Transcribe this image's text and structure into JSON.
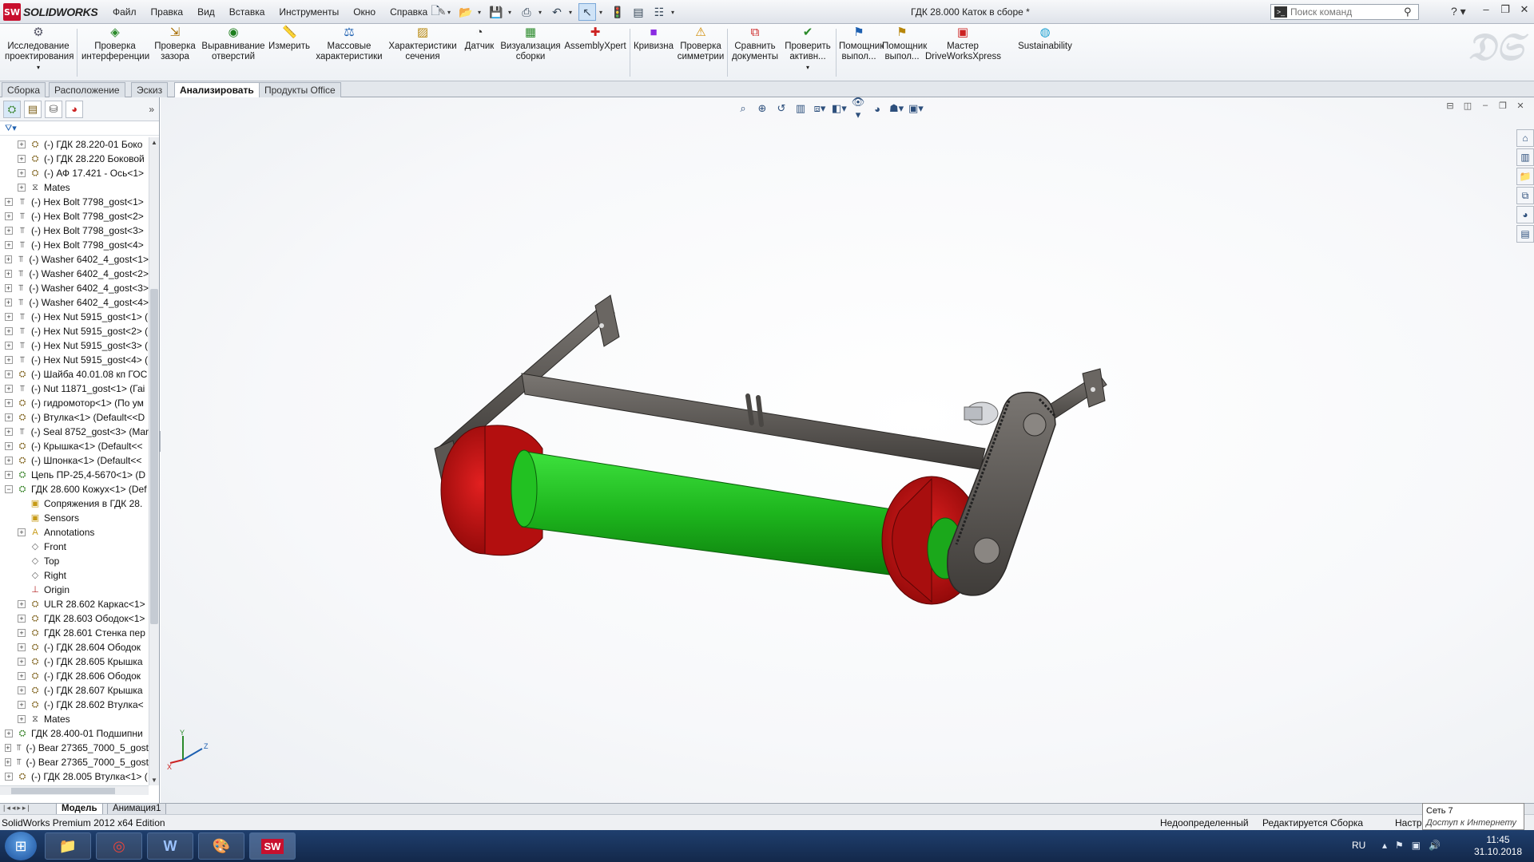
{
  "titlebar": {
    "app_logo_mark": "SW",
    "app_name": "SOLIDWORKS",
    "menu": [
      "Файл",
      "Правка",
      "Вид",
      "Вставка",
      "Инструменты",
      "Окно",
      "Справка"
    ],
    "document_title": "ГДК 28.000 Каток в сборе *",
    "search_placeholder": "Поиск команд",
    "help_label": "?"
  },
  "ribbon": {
    "buttons": [
      {
        "label": "Исследование проектирования",
        "icon": "design-study-icon"
      },
      {
        "label": "Проверка интерференции",
        "icon": "interference-icon"
      },
      {
        "label": "Проверка зазора",
        "icon": "clearance-icon"
      },
      {
        "label": "Выравнивание отверстий",
        "icon": "hole-alignment-icon"
      },
      {
        "label": "Измерить",
        "icon": "measure-icon"
      },
      {
        "label": "Массовые характеристики",
        "icon": "mass-properties-icon"
      },
      {
        "label": "Характеристики сечения",
        "icon": "section-properties-icon"
      },
      {
        "label": "Датчик",
        "icon": "sensor-icon"
      },
      {
        "label": "Визуализация сборки",
        "icon": "assembly-visualization-icon"
      },
      {
        "label": "AssemblyXpert",
        "icon": "assemblyxpert-icon"
      },
      {
        "label": "Кривизна",
        "icon": "curvature-icon"
      },
      {
        "label": "Проверка симметрии",
        "icon": "symmetry-check-icon"
      },
      {
        "label": "Сравнить документы",
        "icon": "compare-documents-icon"
      },
      {
        "label": "Проверить активн...",
        "icon": "check-active-icon"
      },
      {
        "label": "Помощник выпол...",
        "icon": "assistant-icon"
      },
      {
        "label": "Помощник выпол...",
        "icon": "assistant-icon"
      },
      {
        "label": "Мастер DriveWorksXpress",
        "icon": "driveworks-icon"
      },
      {
        "label": "Sustainability",
        "icon": "sustainability-icon"
      }
    ]
  },
  "tabs": [
    {
      "label": "Сборка",
      "active": false
    },
    {
      "label": "Расположение",
      "active": false
    },
    {
      "label": "Эскиз",
      "active": false
    },
    {
      "label": "Анализировать",
      "active": true
    },
    {
      "label": "Продукты Office",
      "active": false
    }
  ],
  "tree": {
    "items": [
      {
        "label": "(-) ГДК 28.220-01 Боко",
        "icon": "part",
        "level": 1
      },
      {
        "label": "(-) ГДК 28.220 Боковой",
        "icon": "part",
        "level": 1
      },
      {
        "label": "(-) АФ 17.421 - Ось<1>",
        "icon": "part",
        "level": 1
      },
      {
        "label": "Mates",
        "icon": "mates",
        "level": 1
      },
      {
        "label": "(-) Hex Bolt 7798_gost<1>",
        "icon": "bolt",
        "level": 0
      },
      {
        "label": "(-) Hex Bolt 7798_gost<2>",
        "icon": "bolt",
        "level": 0
      },
      {
        "label": "(-) Hex Bolt 7798_gost<3>",
        "icon": "bolt",
        "level": 0
      },
      {
        "label": "(-) Hex Bolt 7798_gost<4>",
        "icon": "bolt",
        "level": 0
      },
      {
        "label": "(-) Washer 6402_4_gost<1>",
        "icon": "bolt",
        "level": 0
      },
      {
        "label": "(-) Washer 6402_4_gost<2>",
        "icon": "bolt",
        "level": 0
      },
      {
        "label": "(-) Washer 6402_4_gost<3>",
        "icon": "bolt",
        "level": 0
      },
      {
        "label": "(-) Washer 6402_4_gost<4>",
        "icon": "bolt",
        "level": 0
      },
      {
        "label": "(-) Hex Nut 5915_gost<1> (",
        "icon": "bolt",
        "level": 0
      },
      {
        "label": "(-) Hex Nut 5915_gost<2> (",
        "icon": "bolt",
        "level": 0
      },
      {
        "label": "(-) Hex Nut 5915_gost<3> (",
        "icon": "bolt",
        "level": 0
      },
      {
        "label": "(-) Hex Nut 5915_gost<4> (",
        "icon": "bolt",
        "level": 0
      },
      {
        "label": "(-) Шайба 40.01.08 кп ГОС",
        "icon": "part",
        "level": 0
      },
      {
        "label": "(-) Nut 11871_gost<1> (Гаі",
        "icon": "bolt",
        "level": 0
      },
      {
        "label": "(-) гидромотор<1> (По ум",
        "icon": "part",
        "level": 0
      },
      {
        "label": "(-) Втулка<1> (Default<<D",
        "icon": "part",
        "level": 0
      },
      {
        "label": "(-) Seal 8752_gost<3> (Mar",
        "icon": "bolt",
        "level": 0
      },
      {
        "label": "(-) Крышка<1> (Default<<",
        "icon": "part",
        "level": 0
      },
      {
        "label": "(-) Шпонка<1> (Default<<",
        "icon": "part",
        "level": 0
      },
      {
        "label": "Цепь ПР-25,4-5670<1> (D",
        "icon": "assy",
        "level": 0
      },
      {
        "label": "ГДК 28.600 Кожух<1> (Def",
        "icon": "assy",
        "level": 0,
        "expanded": true
      },
      {
        "label": "Сопряжения в ГДК 28.",
        "icon": "folder",
        "level": 1
      },
      {
        "label": "Sensors",
        "icon": "folder",
        "level": 1
      },
      {
        "label": "Annotations",
        "icon": "annotation",
        "level": 1
      },
      {
        "label": "Front",
        "icon": "plane",
        "level": 1
      },
      {
        "label": "Top",
        "icon": "plane",
        "level": 1
      },
      {
        "label": "Right",
        "icon": "plane",
        "level": 1
      },
      {
        "label": "Origin",
        "icon": "origin",
        "level": 1
      },
      {
        "label": "ULR 28.602 Каркас<1>",
        "icon": "part",
        "level": 1
      },
      {
        "label": "ГДК 28.603 Ободок<1>",
        "icon": "part",
        "level": 1
      },
      {
        "label": "ГДК 28.601 Стенка пер",
        "icon": "part",
        "level": 1
      },
      {
        "label": "(-) ГДК 28.604 Ободок",
        "icon": "part",
        "level": 1
      },
      {
        "label": "(-) ГДК 28.605 Крышка",
        "icon": "part",
        "level": 1
      },
      {
        "label": "(-) ГДК 28.606 Ободок",
        "icon": "part",
        "level": 1
      },
      {
        "label": "(-) ГДК 28.607 Крышка",
        "icon": "part",
        "level": 1
      },
      {
        "label": "(-) ГДК 28.602 Втулка<",
        "icon": "part",
        "level": 1
      },
      {
        "label": "Mates",
        "icon": "mates",
        "level": 1
      },
      {
        "label": "ГДК 28.400-01 Подшипни",
        "icon": "assy",
        "level": 0
      },
      {
        "label": "(-) Bear 27365_7000_5_gost",
        "icon": "bolt",
        "level": 0
      },
      {
        "label": "(-) Bear 27365_7000_5_gost",
        "icon": "bolt",
        "level": 0
      },
      {
        "label": "(-) ГДК 28.005 Втулка<1> (",
        "icon": "part",
        "level": 0
      }
    ]
  },
  "triad": {
    "x_label": "X",
    "y_label": "Y",
    "z_label": "Z"
  },
  "model_tabs": [
    {
      "label": "Модель",
      "active": true
    },
    {
      "label": "Анимация1",
      "active": false
    }
  ],
  "status": {
    "edition": "SolidWorks Premium 2012 x64 Edition",
    "definition": "Недоопределенный",
    "editing": "Редактируется Сборка",
    "units_partial": "Настр"
  },
  "network_tooltip": {
    "title": "Сеть 7",
    "subtitle": "Доступ к Интернету"
  },
  "taskbar": {
    "apps": [
      "windows-explorer",
      "chrome",
      "word",
      "paint",
      "solidworks"
    ],
    "language": "RU",
    "time": "11:45",
    "date": "31.10.2018"
  },
  "colors": {
    "roller_green": "#1db51d",
    "flange_red": "#c90f0f",
    "frame_gray": "#5b5753",
    "accent_blue": "#2d4f7c"
  }
}
